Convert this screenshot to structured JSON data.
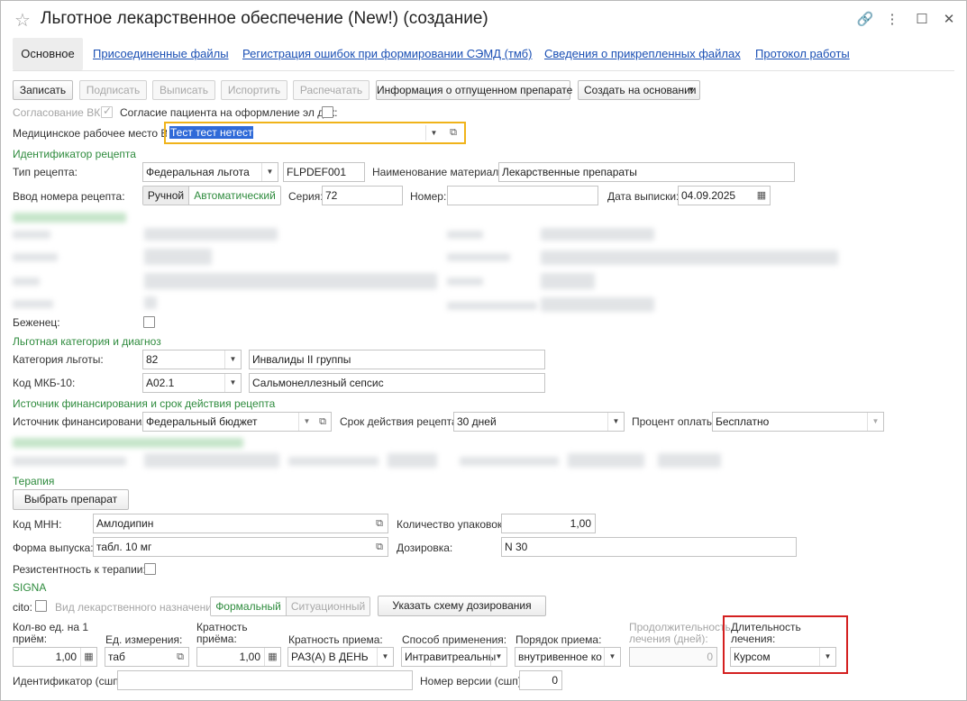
{
  "window": {
    "title": "Льготное лекарственное обеспечение (New!) (создание)"
  },
  "tabs": [
    {
      "label": "Основное"
    },
    {
      "label": "Присоединенные файлы"
    },
    {
      "label": "Регистрация ошибок при формировании СЭМД (тмб)"
    },
    {
      "label": "Сведения о прикрепленных файлах"
    },
    {
      "label": "Протокол работы"
    }
  ],
  "toolbar": {
    "save": "Записать",
    "sign": "Подписать",
    "issue": "Выписать",
    "spoil": "Испортить",
    "print": "Распечатать",
    "info": "Информация о отпущенном препарате",
    "create_based": "Создать на основании"
  },
  "vk": {
    "agreement_label": "Согласование ВК:",
    "consent_label": "Согласие пациента на оформление эл док:",
    "workplace_label": "Медицинское рабочее место ВК:",
    "workplace_value": "Тест тест нетест"
  },
  "recipe": {
    "group": "Идентификатор рецепта",
    "type_label": "Тип рецепта:",
    "type_value": "Федеральная льгота",
    "code_value": "FLPDEF001",
    "material_label": "Наименование материала:",
    "material_value": "Лекарственные препараты",
    "number_input_label": "Ввод номера рецепта:",
    "manual": "Ручной",
    "auto": "Автоматический",
    "series_label": "Серия:",
    "series_value": "72",
    "number_label": "Номер:",
    "number_value": "",
    "date_label": "Дата выписки:",
    "date_value": "04.09.2025"
  },
  "refugee": {
    "label": "Беженец:"
  },
  "benefit": {
    "group": "Льготная категория и диагноз",
    "category_label": "Категория льготы:",
    "category_code": "82",
    "category_name": "Инвалиды II группы",
    "mkb_label": "Код МКБ-10:",
    "mkb_code": "A02.1",
    "mkb_name": "Сальмонеллезный сепсис"
  },
  "finance": {
    "group": "Источник финансирования и срок действия рецепта",
    "source_label": "Источник финансирования:",
    "source_value": "Федеральный бюджет",
    "validity_label": "Срок действия рецепта:",
    "validity_value": "30 дней",
    "payment_label": "Процент оплаты:",
    "payment_value": "Бесплатно"
  },
  "therapy": {
    "group": "Терапия",
    "choose_button": "Выбрать препарат",
    "mnn_label": "Код МНН:",
    "mnn_value": "Амлодипин",
    "packs_label": "Количество упаковок:",
    "packs_value": "1,00",
    "form_label": "Форма выпуска:",
    "form_value": "табл. 10 мг",
    "dosage_label": "Дозировка:",
    "dosage_value": "N 30",
    "resistance_label": "Резистентность к терапии:"
  },
  "signa": {
    "group": "SIGNA",
    "cito_label": "cito:",
    "purpose_label": "Вид лекарственного назначения:",
    "formal": "Формальный",
    "situational": "Ситуационный",
    "scheme_button": "Указать схему дозирования",
    "qty_label": "Кол-во ед. на 1 приём:",
    "qty_value": "1,00",
    "unit_label": "Ед. измерения:",
    "unit_value": "таб",
    "mult_label": "Кратность приёма:",
    "mult_value": "1,00",
    "freq_label": "Кратность приема:",
    "freq_value": "РАЗ(А) В ДЕНЬ",
    "method_label": "Способ применения:",
    "method_value": "Интравитреальны",
    "order_label": "Порядок приема:",
    "order_value": "внутривенное ко",
    "duration_days_label": "Продолжительность лечения (дней):",
    "duration_days_value": "0",
    "duration_label": "Длительность лечения:",
    "duration_value": "Курсом",
    "id_label": "Идентификатор (сшп):",
    "id_value": "",
    "version_label": "Номер версии (сшп):",
    "version_value": "0"
  },
  "colors": {
    "link": "#1a4fb4",
    "group_green": "#2e8b3d",
    "focus_yellow": "#f0b31a",
    "annotation_red": "#d42020",
    "selection_blue": "#2f6ad8"
  },
  "icons": [
    "star-icon",
    "link-icon",
    "more-icon",
    "maximize-icon",
    "close-icon",
    "dropdown-icon",
    "open-icon",
    "calendar-icon",
    "calculator-icon",
    "checkmark-icon"
  ]
}
